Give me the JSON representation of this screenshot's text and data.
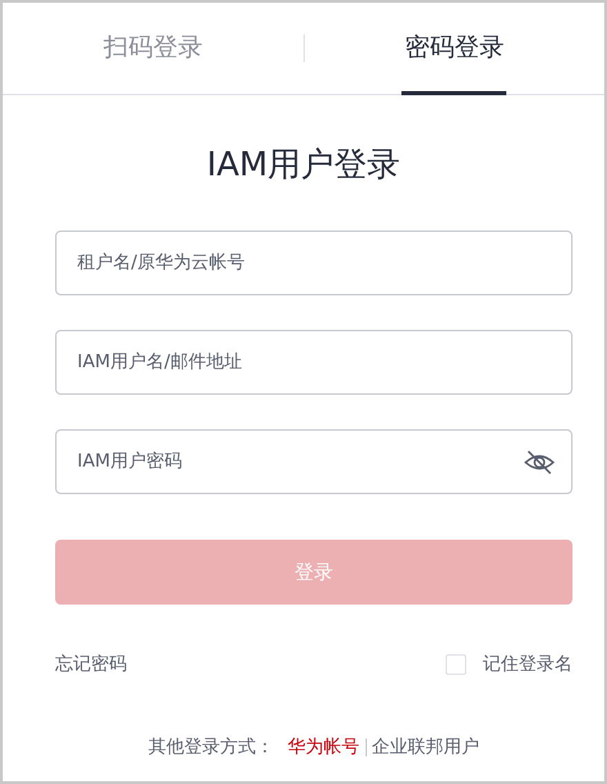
{
  "tabs": [
    {
      "label": "扫码登录",
      "selected": false
    },
    {
      "label": "密码登录",
      "selected": true
    }
  ],
  "title": "IAM用户登录",
  "fields": [
    {
      "placeholder": "租户名/原华为云帐号",
      "kind": "text"
    },
    {
      "placeholder": "IAM用户名/邮件地址",
      "kind": "text"
    },
    {
      "placeholder": "IAM用户密码",
      "kind": "password"
    }
  ],
  "login_button": {
    "label": "登录",
    "disabled": true
  },
  "forgot_link": "忘记密码",
  "remember": {
    "label": "记住登录名",
    "checked": false
  },
  "other_methods": {
    "label": "其他登录方式：",
    "links": [
      {
        "label": "华为帐号",
        "color": "#c7000b"
      },
      {
        "label": "企业联邦用户",
        "color": "#575d6c"
      }
    ]
  }
}
